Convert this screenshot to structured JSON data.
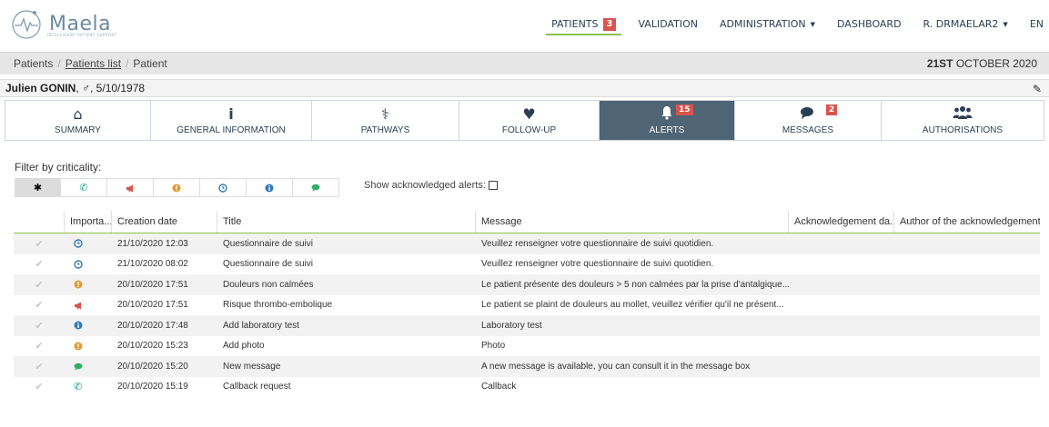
{
  "brand": {
    "name": "Maela",
    "tagline": "INTELLIGENT PATIENT SUPPORT"
  },
  "nav": [
    {
      "label": "PATIENTS",
      "badge": "3",
      "active": true
    },
    {
      "label": "VALIDATION"
    },
    {
      "label": "ADMINISTRATION",
      "dropdown": true
    },
    {
      "label": "DASHBOARD"
    },
    {
      "label": "R. DRMAELAR2",
      "dropdown": true
    },
    {
      "label": "EN"
    }
  ],
  "breadcrumb": {
    "items": [
      "Patients",
      "Patients list",
      "Patient"
    ],
    "date_strong": "21ST",
    "date_rest": " OCTOBER 2020"
  },
  "patient": {
    "name": "Julien GONIN",
    "details": ", ♂, 5/10/1978"
  },
  "tabs": [
    {
      "label": "SUMMARY",
      "icon": "home-icon",
      "glyph": "🏠"
    },
    {
      "label": "GENERAL INFORMATION",
      "icon": "info-icon",
      "glyph": "ℹ"
    },
    {
      "label": "PATHWAYS",
      "icon": "stethoscope-icon",
      "glyph": "⚕"
    },
    {
      "label": "FOLLOW-UP",
      "icon": "heartbeat-icon",
      "glyph": "♥"
    },
    {
      "label": "ALERTS",
      "icon": "bell-icon",
      "glyph": "🔔",
      "badge": "15",
      "active": true
    },
    {
      "label": "MESSAGES",
      "icon": "comments-icon",
      "glyph": "💬",
      "badge": "2"
    },
    {
      "label": "AUTHORISATIONS",
      "icon": "users-icon",
      "glyph": "👥"
    }
  ],
  "filter": {
    "title": "Filter by criticality:",
    "buttons": [
      {
        "name": "all",
        "glyph": "✱",
        "color": "#000000",
        "active": true
      },
      {
        "name": "phone",
        "glyph": "✆",
        "color": "#1a9e8a"
      },
      {
        "name": "megaphone",
        "glyph": "📢",
        "color": "#d9534f"
      },
      {
        "name": "exclamation",
        "glyph": "●",
        "color": "#e29b2f"
      },
      {
        "name": "clock",
        "glyph": "◷",
        "color": "#337ab7"
      },
      {
        "name": "info",
        "glyph": "ℹ",
        "color": "#337ab7"
      },
      {
        "name": "comment",
        "glyph": "●",
        "color": "#2fae6a"
      }
    ],
    "ack_label": "Show acknowledged alerts:"
  },
  "table": {
    "columns": [
      "",
      "Importa...",
      "Creation date",
      "Title",
      "Message",
      "Acknowledgement da...",
      "Author of the acknowledgement"
    ],
    "rows": [
      {
        "icon": "clock-icon",
        "glyph": "◷",
        "color": "#337ab7",
        "date": "21/10/2020 12:03",
        "title": "Questionnaire de suivi",
        "message": "Veuillez renseigner votre questionnaire de suivi quotidien.",
        "ack_date": "",
        "ack_author": ""
      },
      {
        "icon": "clock-icon",
        "glyph": "◷",
        "color": "#337ab7",
        "date": "21/10/2020 08:02",
        "title": "Questionnaire de suivi",
        "message": "Veuillez renseigner votre questionnaire de suivi quotidien.",
        "ack_date": "",
        "ack_author": ""
      },
      {
        "icon": "exclamation-icon",
        "glyph": "●",
        "color": "#e29b2f",
        "date": "20/10/2020 17:51",
        "title": "Douleurs non calmées",
        "message": "Le patient présente des douleurs > 5 non calmées par la prise d'antalgique....",
        "ack_date": "",
        "ack_author": ""
      },
      {
        "icon": "megaphone-icon",
        "glyph": "📢",
        "color": "#d9534f",
        "date": "20/10/2020 17:51",
        "title": "Risque thrombo-embolique",
        "message": "Le patient se plaint de douleurs au mollet, veuillez vérifier qu'il ne présent...",
        "ack_date": "",
        "ack_author": ""
      },
      {
        "icon": "info-icon",
        "glyph": "ℹ",
        "color": "#337ab7",
        "date": "20/10/2020 17:48",
        "title": "Add laboratory test",
        "message": "Laboratory test",
        "ack_date": "",
        "ack_author": ""
      },
      {
        "icon": "exclamation-icon",
        "glyph": "●",
        "color": "#e29b2f",
        "date": "20/10/2020 15:23",
        "title": "Add photo",
        "message": "Photo",
        "ack_date": "",
        "ack_author": ""
      },
      {
        "icon": "comment-icon",
        "glyph": "●",
        "color": "#2fae6a",
        "date": "20/10/2020 15:20",
        "title": "New message",
        "message": "A new message is available, you can consult it in the message box",
        "ack_date": "",
        "ack_author": ""
      },
      {
        "icon": "phone-icon",
        "glyph": "✆",
        "color": "#1a9e8a",
        "date": "20/10/2020 15:19",
        "title": "Callback request",
        "message": "Callback",
        "ack_date": "",
        "ack_author": ""
      }
    ]
  }
}
